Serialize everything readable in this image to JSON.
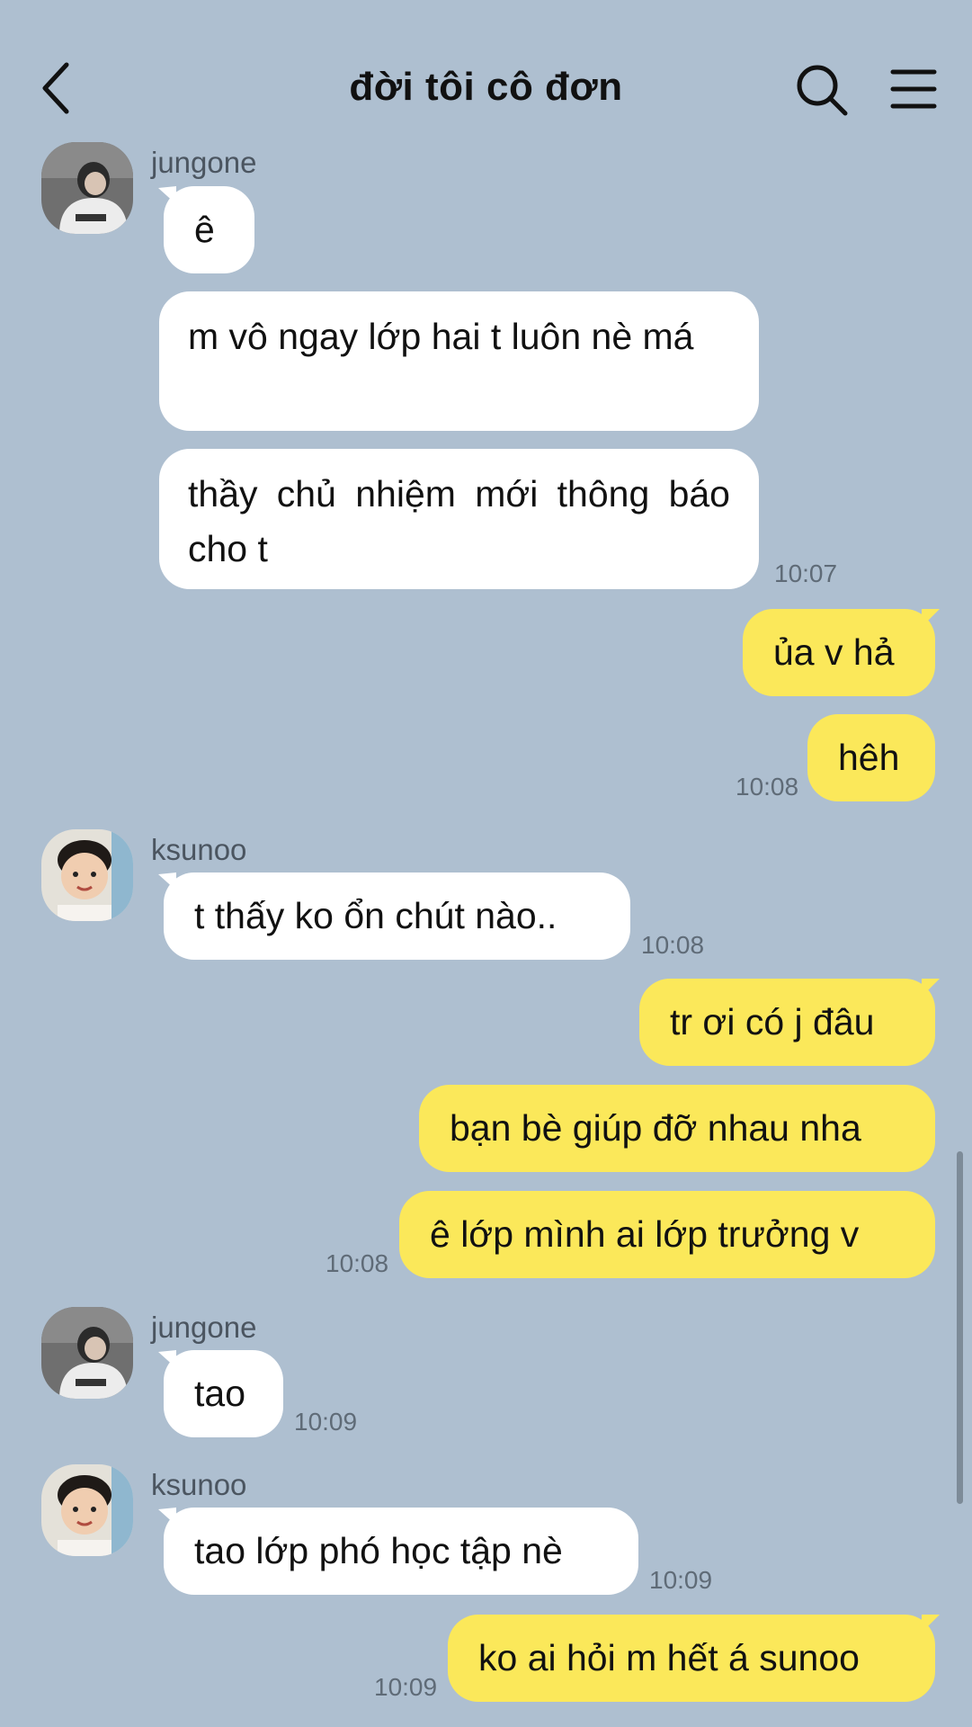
{
  "header": {
    "title": "đời tôi cô đơn",
    "back_icon": "chevron-left-icon",
    "search_icon": "search-icon",
    "menu_icon": "hamburger-menu-icon"
  },
  "colors": {
    "background": "#aebfd0",
    "incoming_bubble": "#ffffff",
    "outgoing_bubble": "#fbe85a"
  },
  "messages": [
    {
      "sender": "jungone",
      "text": "ê"
    },
    {
      "text": "m vô ngay lớp hai t luôn nè má"
    },
    {
      "text": "thầy chủ nhiệm mới thông báo cho t",
      "time": "10:07"
    },
    {
      "outgoing": true,
      "text": "ủa v hả"
    },
    {
      "outgoing": true,
      "text": "hêh",
      "time": "10:08"
    },
    {
      "sender": "ksunoo",
      "text": "t thấy ko ổn chút nào..",
      "time": "10:08"
    },
    {
      "outgoing": true,
      "text": "tr ơi có j đâu"
    },
    {
      "outgoing": true,
      "text": "bạn bè giúp đỡ nhau nha"
    },
    {
      "outgoing": true,
      "text": "ê lớp mình ai lớp trưởng v",
      "time": "10:08"
    },
    {
      "sender": "jungone",
      "text": "tao",
      "time": "10:09"
    },
    {
      "sender": "ksunoo",
      "text": "tao lớp phó học tập nè",
      "time": "10:09"
    },
    {
      "outgoing": true,
      "text": "ko ai hỏi m hết á sunoo",
      "time": "10:09"
    }
  ]
}
